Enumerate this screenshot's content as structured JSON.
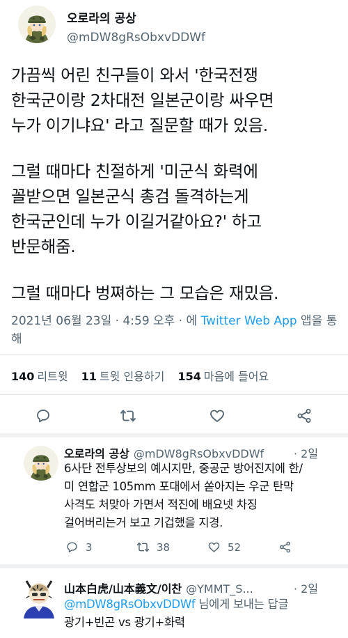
{
  "tweet": {
    "author_name": "오로라의 공상",
    "author_handle": "@mDW8gRsObxvDDWf",
    "lines": [
      "가끔씩 어린 친구들이 와서 '한국전쟁",
      "한국군이랑 2차대전 일본군이랑 싸우면",
      "누가 이기냐요' 라고 질문할 때가 있음.",
      "그럴 때마다 친절하게 '미군식 화력에",
      "꼴받으면 일본군식 총검 돌격하는게",
      "한국군인데 누가 이길거같아요?' 하고",
      "반문해줌.",
      "그럴 때마다 벙쪄하는 그 모습은 재밌음."
    ],
    "meta_date": "2021년 06월 23일 · 4:59 오후 · 에 ",
    "meta_app": "Twitter Web App",
    "meta_suffix": " 앱을 통해",
    "retweets_count": "140",
    "retweets_label": "리트윗",
    "quotes_count": "11",
    "quotes_label": "트윗 인용하기",
    "likes_count": "154",
    "likes_label": "마음에 들어요"
  },
  "replies": [
    {
      "name": "오로라의 공상",
      "handle": "@mDW8gRsObxvDDWf",
      "time": "· 2일",
      "lines": [
        "6사단 전투상보의 예시지만, 중공군 방어진지에 한/",
        "미 연합군 105mm 포대에서 쏟아지는 우군 탄막",
        "사격도 처맞아 가면서 적진에 배요넷 차징",
        "걸어버리는거 보고 기겁했을 지경."
      ],
      "reply_count": "3",
      "retweet_count": "38",
      "like_count": "52"
    },
    {
      "name": "山本白虎/山本義文/이찬",
      "handle": "@YMMT_S...",
      "time": "· 2일",
      "mention": "@mDW8gRsObxvDDWf",
      "mention_suffix": " 님에게 보내는 답글",
      "lines": [
        "광기+빈곤 vs 광기+화력"
      ]
    }
  ],
  "icons": {
    "reply": "reply-icon",
    "retweet": "retweet-icon",
    "like": "heart-icon",
    "share": "share-icon"
  },
  "colors": {
    "link": "#1d9bf0",
    "secondary": "#536471",
    "text": "#0f1419"
  }
}
